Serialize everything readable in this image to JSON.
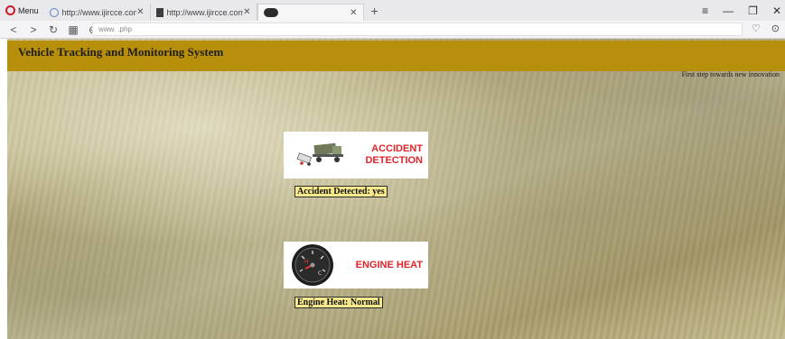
{
  "browser": {
    "menu_label": "Menu",
    "tabs": [
      {
        "title": "http://www.ijircce.com/w"
      },
      {
        "title": "http://www.ijircce.com/"
      },
      {
        "title": ""
      }
    ],
    "newtab_label": "+",
    "url": "www.                                              .php",
    "controls": {
      "minimize": "—",
      "maximize": "❐",
      "close": "✕"
    }
  },
  "page": {
    "site_title": "Vehicle Tracking and Monitoring System",
    "tagline": "First step towards new innovation",
    "accident": {
      "title_line1": "ACCIDENT",
      "title_line2": "DETECTION",
      "status": "Accident Detected: yes"
    },
    "engine": {
      "title": "ENGINE HEAT",
      "status": "Engine Heat: Normal"
    }
  },
  "icons": [
    "opera-logo-icon",
    "globe-icon",
    "document-icon",
    "back-icon",
    "forward-icon",
    "reload-icon",
    "speed-dial-icon",
    "site-info-icon",
    "heart-icon",
    "download-icon",
    "truck-crash-icon",
    "temperature-gauge-icon"
  ],
  "colors": {
    "header": "#b78f0b",
    "card_title": "#e0242a",
    "status_bg": "#f7e98c"
  }
}
